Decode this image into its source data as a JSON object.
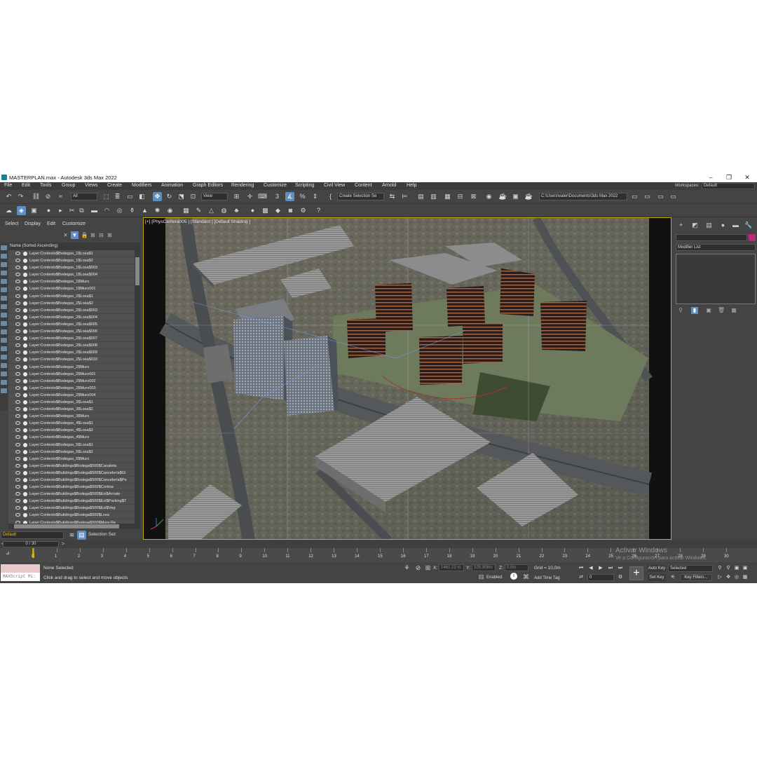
{
  "window": {
    "title": "MASTERPLAN.max - Autodesk 3ds Max 2022",
    "minimize": "–",
    "maximize": "❐",
    "close": "✕"
  },
  "menu": {
    "items": [
      "File",
      "Edit",
      "Tools",
      "Group",
      "Views",
      "Create",
      "Modifiers",
      "Animation",
      "Graph Editors",
      "Rendering",
      "Customize",
      "Scripting",
      "Civil View",
      "Content",
      "Arnold",
      "Help"
    ],
    "workspaces_label": "Workspaces:",
    "workspaces_value": "Default"
  },
  "toolbar": {
    "filter_select": "All",
    "ref_coord": "View",
    "selection_set": "Create Selection Se",
    "project_path": "C:\\Users\\valer\\Documents\\3ds Max 2022"
  },
  "explorer": {
    "menu": [
      "Select",
      "Display",
      "Edit",
      "Customize"
    ],
    "column_header": "Name (Sorted Ascending)",
    "rows": [
      "Layer:Contexto$Bodegas_1$Losa$1",
      "Layer:Contexto$Bodegas_1$Losa$2",
      "Layer:Contexto$Bodegas_1$Losa$003",
      "Layer:Contexto$Bodegas_1$Losa$004",
      "Layer:Contexto$Bodegas_1$Muro",
      "Layer:Contexto$Bodegas_1$Muro001",
      "Layer:Contexto$Bodegas_2$Losa$1",
      "Layer:Contexto$Bodegas_2$Losa$2",
      "Layer:Contexto$Bodegas_2$Losa$003",
      "Layer:Contexto$Bodegas_2$Losa$004",
      "Layer:Contexto$Bodegas_2$Losa$005",
      "Layer:Contexto$Bodegas_2$Losa$006",
      "Layer:Contexto$Bodegas_2$Losa$007",
      "Layer:Contexto$Bodegas_2$Losa$008",
      "Layer:Contexto$Bodegas_2$Losa$009",
      "Layer:Contexto$Bodegas_2$Losa$010",
      "Layer:Contexto$Bodegas_2$Muro",
      "Layer:Contexto$Bodegas_2$Muro001",
      "Layer:Contexto$Bodegas_2$Muro002",
      "Layer:Contexto$Bodegas_2$Muro003",
      "Layer:Contexto$Bodegas_2$Muro004",
      "Layer:Contexto$Bodegas_3$Losa$1",
      "Layer:Contexto$Bodegas_3$Losa$2",
      "Layer:Contexto$Bodegas_3$Muro",
      "Layer:Contexto$Bodegas_4$Losa$1",
      "Layer:Contexto$Bodegas_4$Losa$2",
      "Layer:Contexto$Bodegas_4$Muro",
      "Layer:Contexto$Bodegas_5$Losa$1",
      "Layer:Contexto$Bodegas_5$Losa$2",
      "Layer:Contexto$Bodegas_5$Muro",
      "Layer:Contexto$Buildings$Bodega$500$Canaleta",
      "Layer:Contexto$Buildings$Bodega$500$Cancelería$Gl",
      "Layer:Contexto$Buildings$Bodega$500$Cancelería$Pe",
      "Layer:Contexto$Buildings$Bodega$500$Cortina",
      "Layer:Contexto$Buildings$Bodega$500$Ext$Arriate",
      "Layer:Contexto$Buildings$Bodega$500$Ext$Parking$T",
      "Layer:Contexto$Buildings$Bodega$500$Ext$Veg",
      "Layer:Contexto$Buildings$Bodega$500$Losa",
      "Layer:Contexto$Buildings$Bodega$500$Muro Re"
    ],
    "layer_select": "Default",
    "selection_set_label": "Selection Set:"
  },
  "viewport": {
    "label": "[+] [PhysCamera005 ] [Standard ] [Default Shading ]"
  },
  "command_panel": {
    "modifier_list": "Modifier List",
    "color_swatch": "#c2247e"
  },
  "timeline": {
    "frame_counter": "0 / 30",
    "ticks": [
      "0",
      "1",
      "2",
      "3",
      "4",
      "5",
      "6",
      "7",
      "8",
      "9",
      "10",
      "11",
      "12",
      "13",
      "14",
      "15",
      "16",
      "17",
      "18",
      "19",
      "20",
      "21",
      "22",
      "23",
      "24",
      "25",
      "26",
      "27",
      "28",
      "29",
      "30"
    ]
  },
  "status": {
    "maxscript": "MAXScript Mi:",
    "selection": "None Selected",
    "prompt": "Click and drag to select and move objects",
    "x_label": "X:",
    "x_value": "1461.22 m",
    "y_label": "Y:",
    "y_value": "105.908m",
    "z_label": "Z:",
    "z_value": "0.0m",
    "grid": "Grid = 10,0m",
    "enabled": "Enabled:",
    "add_time_tag": "Add Time Tag",
    "auto_key": "Auto Key",
    "set_key": "Set Key",
    "selected": "Selected",
    "key_filters": "Key Filters...",
    "current_frame": "0",
    "activate_title": "Activar Windows",
    "activate_sub": "Ve a Configuración para activar Windows."
  }
}
